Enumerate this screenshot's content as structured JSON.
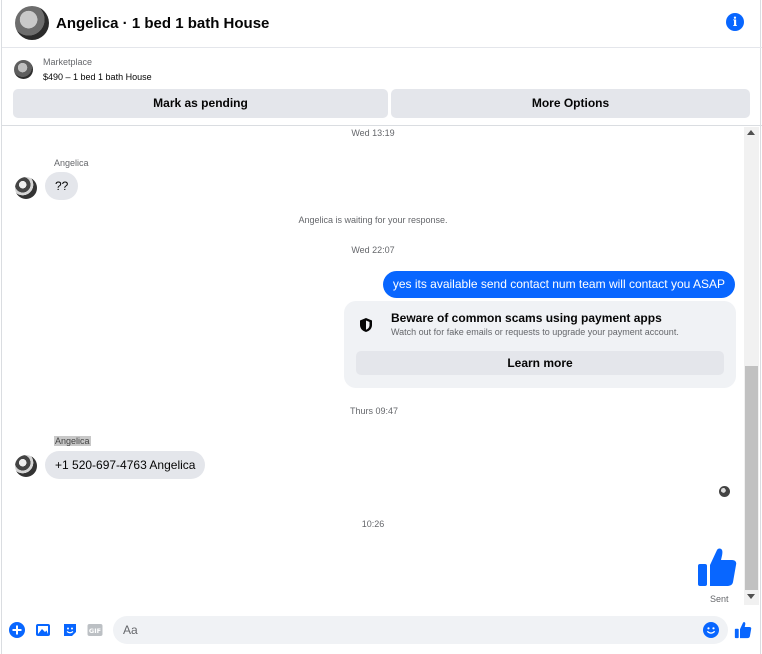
{
  "header": {
    "title": "Angelica · 1 bed 1 bath House",
    "info_icon": "info-icon"
  },
  "marketplace": {
    "label": "Marketplace",
    "listing": "$490 – 1 bed 1 bath House",
    "buttons": {
      "pending": "Mark as pending",
      "more": "More Options"
    }
  },
  "chat": {
    "stamp1": "Wed 13:19",
    "sender1": "Angelica",
    "msg1": "??",
    "system_note": "Angelica is waiting for your response.",
    "stamp2": "Wed 22:07",
    "out1": "yes its available send contact num team will contact you ASAP",
    "scam": {
      "title": "Beware of common scams using payment apps",
      "subtitle": "Watch out for fake emails or requests to upgrade your payment account.",
      "button": "Learn more"
    },
    "stamp3": "Thurs 09:47",
    "sender2": "Angelica",
    "msg2": "+1 520-697-4763 Angelica",
    "stamp4": "10:26",
    "sent_label": "Sent"
  },
  "composer": {
    "placeholder": "Aa"
  },
  "colors": {
    "accent": "#0866ff",
    "bubble_in": "#e4e6eb",
    "card_bg": "#f0f2f5"
  }
}
